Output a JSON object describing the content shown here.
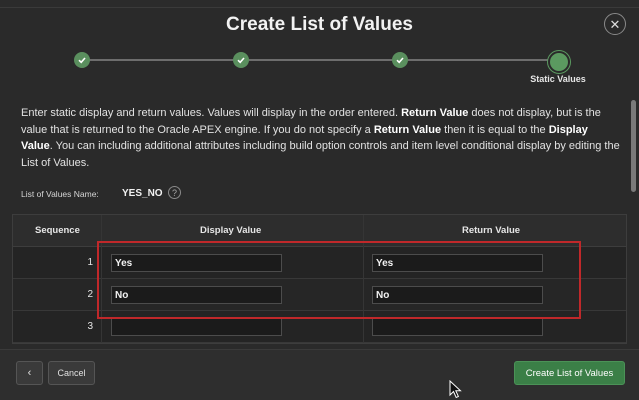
{
  "dialog": {
    "title": "Create List of Values",
    "close_glyph": "✕"
  },
  "wizard": {
    "steps": [
      {
        "status": "complete",
        "icon": "check-icon"
      },
      {
        "status": "complete",
        "icon": "check-icon"
      },
      {
        "status": "complete",
        "icon": "check-icon"
      },
      {
        "status": "current",
        "label": "Static Values"
      }
    ]
  },
  "instructions": {
    "p1": "Enter static display and return values. Values will display in the order entered. ",
    "b1": "Return Value",
    "p2": " does not display, but is the value that is returned to the Oracle APEX engine. If you do not specify a ",
    "b2": "Return Value",
    "p3": " then it is equal to the ",
    "b3": "Display Value",
    "p4": ". You can including additional attributes including build option controls and item level conditional display by editing the List of Values."
  },
  "lov": {
    "label": "List of Values Name:",
    "value": "YES_NO",
    "help_glyph": "?"
  },
  "grid": {
    "headers": {
      "sequence": "Sequence",
      "display": "Display Value",
      "return": "Return Value"
    },
    "rows": [
      {
        "sequence": "1",
        "display": "Yes",
        "return": "Yes"
      },
      {
        "sequence": "2",
        "display": "No",
        "return": "No"
      },
      {
        "sequence": "3",
        "display": "",
        "return": ""
      }
    ]
  },
  "footer": {
    "back_glyph": "‹",
    "cancel_label": "Cancel",
    "create_label": "Create List of Values"
  },
  "colors": {
    "accent_green": "#3b7f47",
    "step_green": "#5a8f5e",
    "highlight_red": "#c0282a"
  }
}
